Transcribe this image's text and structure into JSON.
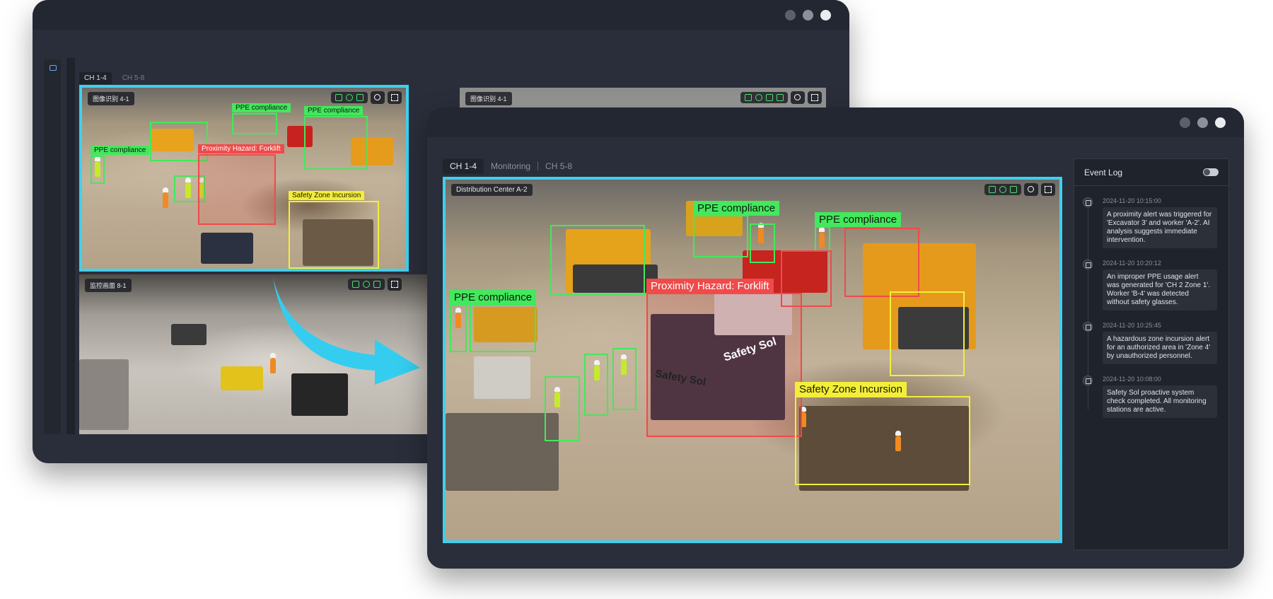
{
  "back_window": {
    "tabs": [
      "CH 1-4",
      "CH 5-8"
    ],
    "feeds": [
      {
        "label": "图像识别 4-1"
      },
      {
        "label": "图像识别 4-1"
      },
      {
        "label": "监控画面 8-1"
      }
    ],
    "annotations": {
      "ppe1": "PPE compliance",
      "ppe2": "PPE compliance",
      "ppe3": "PPE compliance",
      "proximity": "Proximity Hazard: Forklift",
      "zone": "Safety Zone Incursion"
    }
  },
  "front_window": {
    "tabs": [
      "CH 1-4",
      "Monitoring",
      "CH 5-8"
    ],
    "feed": {
      "label": "Distribution Center A-2",
      "annotations": {
        "ppe_left": "PPE compliance",
        "ppe_center": "PPE compliance",
        "ppe_right": "PPE compliance",
        "proximity": "Proximity Hazard: Forklift",
        "zone": "Safety Zone Incursion",
        "truck_text1": "Safety Sol",
        "truck_text2": "Safety Sol"
      }
    },
    "event_log": {
      "title": "Event Log",
      "events": [
        {
          "time": "2024-11-20 10:15:00",
          "text": "A proximity alert was triggered for 'Excavator 3' and worker 'A-2'. AI analysis suggests immediate intervention."
        },
        {
          "time": "2024-11-20 10:20:12",
          "text": "An improper PPE usage alert was generated for 'CH 2 Zone 1'. Worker 'B-4' was detected without safety glasses."
        },
        {
          "time": "2024-11-20 10:25:45",
          "text": "A hazardous zone incursion alert for an authorized area in 'Zone 4' by unauthorized personnel."
        },
        {
          "time": "2024-11-20 10:08:00",
          "text": "Safety Sol proactive system check completed. All monitoring stations are active."
        }
      ]
    }
  },
  "colors": {
    "accent": "#3fd0ee",
    "ppe": "#43e85c",
    "hazard": "#f04a4a",
    "zone": "#f3ee3a"
  }
}
